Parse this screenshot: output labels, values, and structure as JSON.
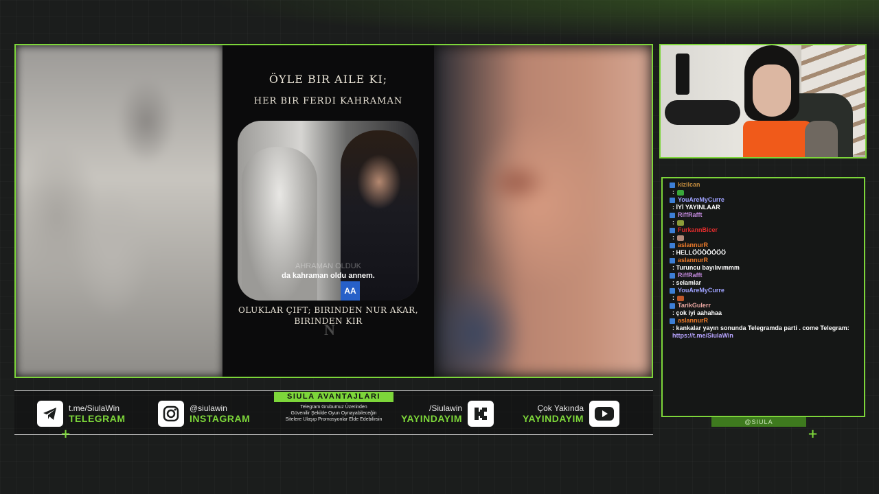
{
  "video": {
    "title_line1": "ÖYLE BIR AILE KI;",
    "title_line2": "HER BIR FERDI KAHRAMAN",
    "caption": "da kahraman oldu annem.",
    "caption_ghost": "AHRAMAN OLDUK",
    "mic_badge": "AA",
    "subtitle": "OLUKLAR ÇIFT; BIRINDEN NUR AKAR, BIRINDEN KIR",
    "watermark": "N"
  },
  "chat": {
    "messages": [
      {
        "user": "kizilcan",
        "color": "#c08a3e",
        "text": ":",
        "emote": "#3aa83a"
      },
      {
        "user": "YouAreMyCurre",
        "color": "#9fa3ff",
        "text": ": İYİ YAYINLAAR"
      },
      {
        "user": "RiffRafft",
        "color": "#c58be0",
        "text": ":",
        "emote": "#8c9d3a"
      },
      {
        "user": "FurkannBicer",
        "color": "#e02c2c",
        "text": ":",
        "emote": "#b48a7a"
      },
      {
        "user": "aslannurR",
        "color": "#ef7b2a",
        "text": ": HELLÖÖÖÖÖÖÖ"
      },
      {
        "user": "aslannurR",
        "color": "#ef7b2a",
        "text": ": Turuncu bayılıvımmm"
      },
      {
        "user": "RiffRafft",
        "color": "#c58be0",
        "text": ": selamlar"
      },
      {
        "user": "YouAreMyCurre",
        "color": "#9fa3ff",
        "text": ":",
        "emote": "#c0582a"
      },
      {
        "user": "TarikGulerr",
        "color": "#e8a6a0",
        "text": ": çok iyi aahahaa"
      },
      {
        "user": "aslannurR",
        "color": "#ef7b2a",
        "text": ": kankalar yayın sonunda Telegramda parti . come Telegram:",
        "link": "https://t.me/SiulaWin"
      }
    ]
  },
  "handle_bar": "@SIULA",
  "socials": [
    {
      "icon": "telegram-icon",
      "handle": "t.me/SiulaWin",
      "label": "TELEGRAM"
    },
    {
      "icon": "instagram-icon",
      "handle": "@siulawin",
      "label": "INSTAGRAM"
    },
    {
      "icon": "kick-icon",
      "handle": "/Siulawin",
      "label": "YAYINDAYIM"
    },
    {
      "icon": "youtube-icon",
      "handle": "Çok Yakında",
      "label": "YAYINDAYIM"
    }
  ],
  "promo": {
    "title": "SIULA AVANTAJLARI",
    "line1": "Telegram Grubumuz Üzerinden",
    "line2": "Güvenilir Şekilde Oyun Oynayabileceğin",
    "line3": "Sitelere Ulaşıp Promosyonlar Elde Edebilirsin"
  },
  "colors": {
    "accent": "#7dd63a",
    "background": "#1b1d1c"
  }
}
